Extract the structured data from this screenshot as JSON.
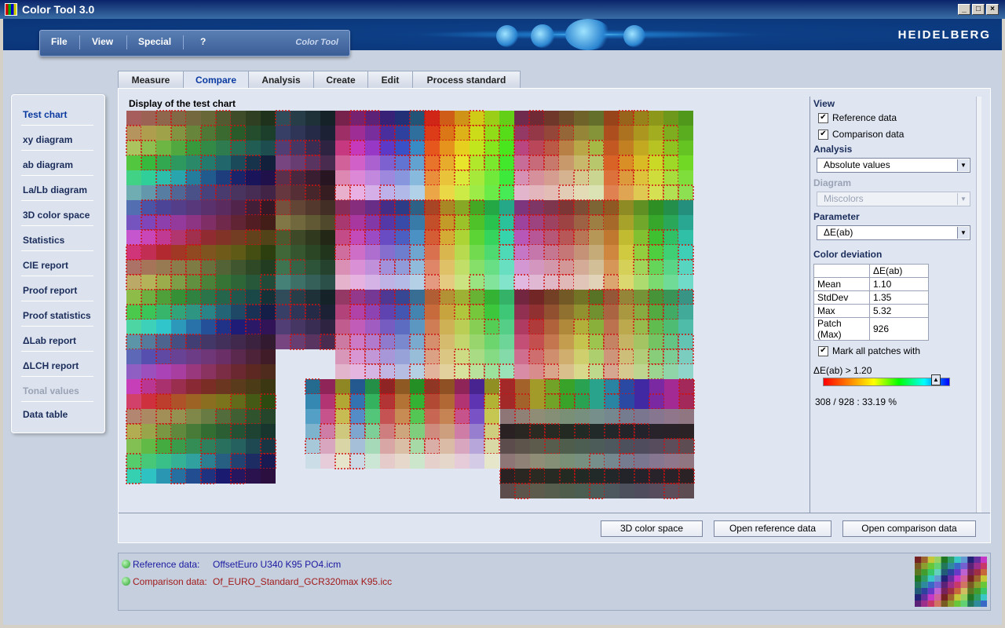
{
  "window": {
    "title": "Color Tool 3.0"
  },
  "header": {
    "brand": "HEIDELBERG"
  },
  "menu": {
    "items": [
      "File",
      "View",
      "Special",
      "?"
    ],
    "brand": "Color Tool"
  },
  "tabs": [
    "Measure",
    "Compare",
    "Analysis",
    "Create",
    "Edit",
    "Process standard"
  ],
  "active_tab": "Compare",
  "sidebar": {
    "items": [
      "Test chart",
      "xy diagram",
      "ab diagram",
      "La/Lb diagram",
      "3D color space",
      "Statistics",
      "CIE report",
      "Proof report",
      "Proof statistics",
      "ΔLab report",
      "ΔLCH report",
      "Tonal values",
      "Data table"
    ],
    "active": "Test chart",
    "disabled": [
      "Tonal values"
    ]
  },
  "chart": {
    "title": "Display of the test chart"
  },
  "right_panel": {
    "view_head": "View",
    "reference_label": "Reference data",
    "reference_checked": true,
    "comparison_label": "Comparison data",
    "comparison_checked": true,
    "analysis_head": "Analysis",
    "analysis_value": "Absolute values",
    "diagram_head": "Diagram",
    "diagram_value": "Miscolors",
    "parameter_head": "Parameter",
    "parameter_value": "ΔE(ab)",
    "deviation_head": "Color deviation",
    "deviation_table": {
      "column": "ΔE(ab)",
      "rows": [
        {
          "label": "Mean",
          "value": "1.10"
        },
        {
          "label": "StdDev",
          "value": "1.35"
        },
        {
          "label": "Max",
          "value": "5.32"
        },
        {
          "label": "Patch (Max)",
          "value": "926"
        }
      ]
    },
    "mark_label": "Mark all patches with",
    "mark_checked": true,
    "threshold_label": "ΔE(ab) > 1.20",
    "threshold_fraction": 0.9,
    "count_text": "308 / 928 : 33.19 %"
  },
  "buttons": {
    "color_space": "3D color space",
    "open_reference": "Open reference data",
    "open_comparison": "Open comparison data"
  },
  "status": {
    "reference_label": "Reference data:",
    "reference_file": "OffsetEuro U340 K95 PO4.icm",
    "comparison_label": "Comparison data:",
    "comparison_file": "Of_EURO_Standard_GCR320max K95.icc",
    "reference_color": "#1a1aa0",
    "comparison_color": "#a01a1a"
  }
}
